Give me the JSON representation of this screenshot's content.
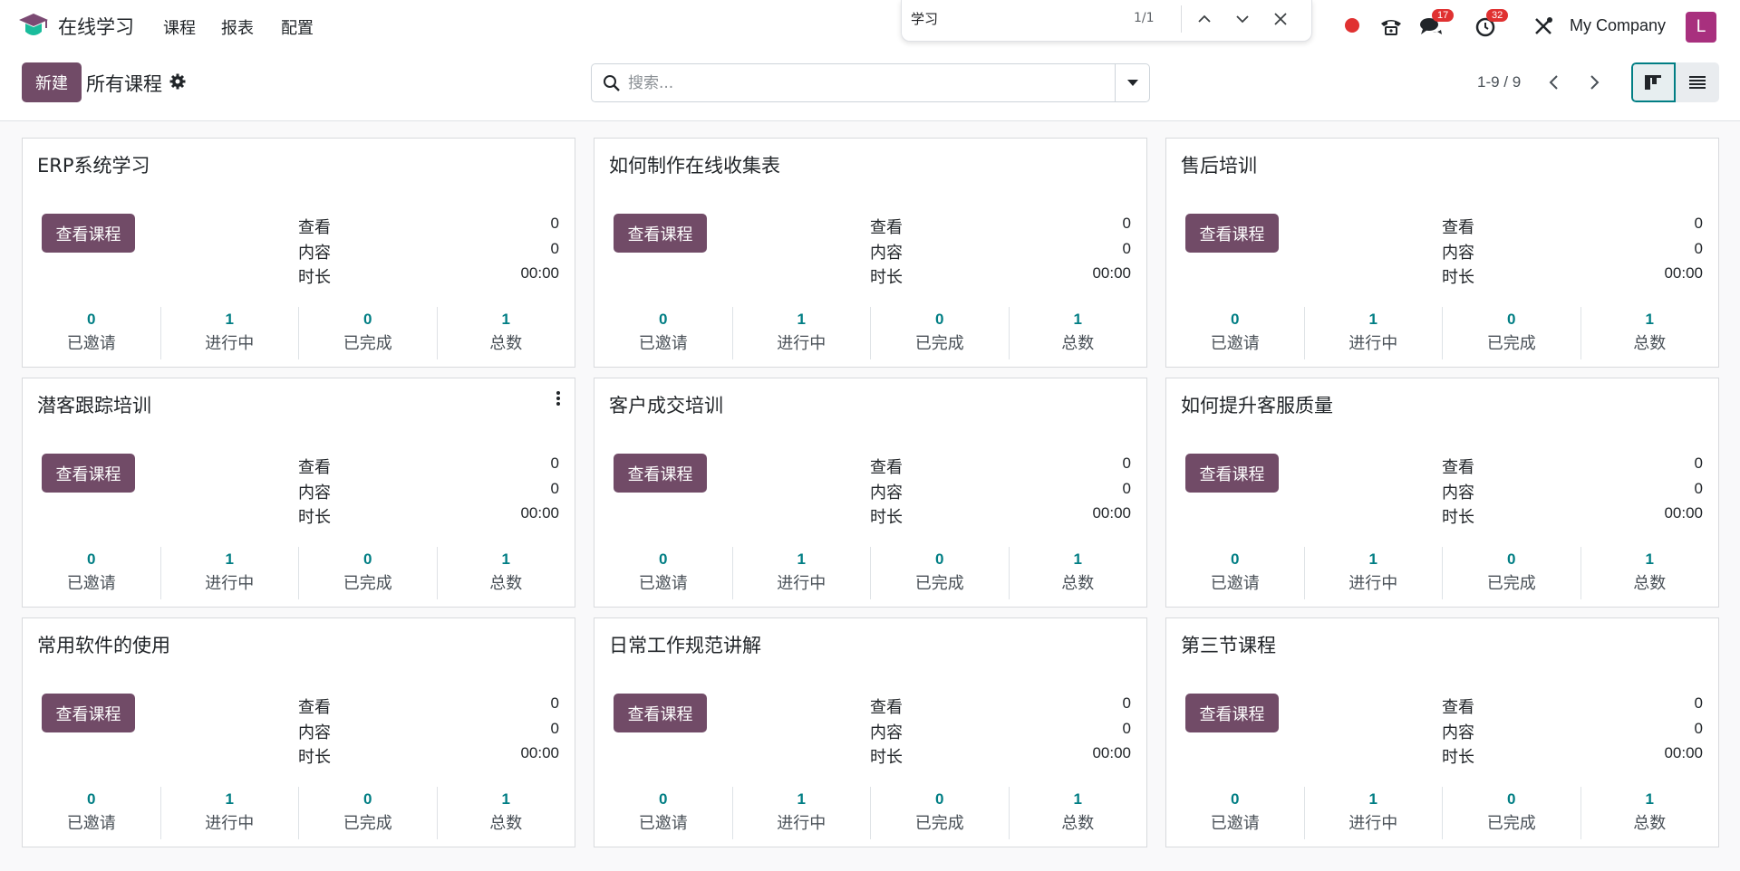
{
  "app": {
    "name": "在线学习",
    "menu": [
      "课程",
      "报表",
      "配置"
    ]
  },
  "findbar": {
    "query": "学习",
    "count": "1/1"
  },
  "systray": {
    "chat_badge": "17",
    "activity_badge": "32",
    "company": "My Company",
    "avatar_letter": "L"
  },
  "control": {
    "new_label": "新建",
    "breadcrumb": "所有课程",
    "search_placeholder": "搜索...",
    "pager": "1-9 / 9"
  },
  "icons": {
    "logo": "graduation-cap-icon",
    "view_kanban": "kanban-icon",
    "view_list": "list-icon"
  },
  "colors": {
    "primary": "#714b67",
    "accent": "#017e84",
    "badge": "#e03131",
    "avatar": "#a8307e"
  },
  "cards": [
    {
      "title": "ERP系统学习",
      "button": "查看课程",
      "stats": [
        {
          "label": "查看",
          "value": "0"
        },
        {
          "label": "内容",
          "value": "0"
        },
        {
          "label": "时长",
          "value": "00:00"
        }
      ],
      "counts": [
        {
          "num": "0",
          "label": "已邀请"
        },
        {
          "num": "1",
          "label": "进行中"
        },
        {
          "num": "0",
          "label": "已完成"
        },
        {
          "num": "1",
          "label": "总数"
        }
      ]
    },
    {
      "title": "如何制作在线收集表",
      "button": "查看课程",
      "stats": [
        {
          "label": "查看",
          "value": "0"
        },
        {
          "label": "内容",
          "value": "0"
        },
        {
          "label": "时长",
          "value": "00:00"
        }
      ],
      "counts": [
        {
          "num": "0",
          "label": "已邀请"
        },
        {
          "num": "1",
          "label": "进行中"
        },
        {
          "num": "0",
          "label": "已完成"
        },
        {
          "num": "1",
          "label": "总数"
        }
      ]
    },
    {
      "title": "售后培训",
      "button": "查看课程",
      "stats": [
        {
          "label": "查看",
          "value": "0"
        },
        {
          "label": "内容",
          "value": "0"
        },
        {
          "label": "时长",
          "value": "00:00"
        }
      ],
      "counts": [
        {
          "num": "0",
          "label": "已邀请"
        },
        {
          "num": "1",
          "label": "进行中"
        },
        {
          "num": "0",
          "label": "已完成"
        },
        {
          "num": "1",
          "label": "总数"
        }
      ]
    },
    {
      "title": "潜客跟踪培训",
      "button": "查看课程",
      "stats": [
        {
          "label": "查看",
          "value": "0"
        },
        {
          "label": "内容",
          "value": "0"
        },
        {
          "label": "时长",
          "value": "00:00"
        }
      ],
      "counts": [
        {
          "num": "0",
          "label": "已邀请"
        },
        {
          "num": "1",
          "label": "进行中"
        },
        {
          "num": "0",
          "label": "已完成"
        },
        {
          "num": "1",
          "label": "总数"
        }
      ]
    },
    {
      "title": "客户成交培训",
      "button": "查看课程",
      "stats": [
        {
          "label": "查看",
          "value": "0"
        },
        {
          "label": "内容",
          "value": "0"
        },
        {
          "label": "时长",
          "value": "00:00"
        }
      ],
      "counts": [
        {
          "num": "0",
          "label": "已邀请"
        },
        {
          "num": "1",
          "label": "进行中"
        },
        {
          "num": "0",
          "label": "已完成"
        },
        {
          "num": "1",
          "label": "总数"
        }
      ]
    },
    {
      "title": "如何提升客服质量",
      "button": "查看课程",
      "stats": [
        {
          "label": "查看",
          "value": "0"
        },
        {
          "label": "内容",
          "value": "0"
        },
        {
          "label": "时长",
          "value": "00:00"
        }
      ],
      "counts": [
        {
          "num": "0",
          "label": "已邀请"
        },
        {
          "num": "1",
          "label": "进行中"
        },
        {
          "num": "0",
          "label": "已完成"
        },
        {
          "num": "1",
          "label": "总数"
        }
      ]
    },
    {
      "title": "常用软件的使用",
      "button": "查看课程",
      "stats": [
        {
          "label": "查看",
          "value": "0"
        },
        {
          "label": "内容",
          "value": "0"
        },
        {
          "label": "时长",
          "value": "00:00"
        }
      ],
      "counts": [
        {
          "num": "0",
          "label": "已邀请"
        },
        {
          "num": "1",
          "label": "进行中"
        },
        {
          "num": "0",
          "label": "已完成"
        },
        {
          "num": "1",
          "label": "总数"
        }
      ]
    },
    {
      "title": "日常工作规范讲解",
      "button": "查看课程",
      "stats": [
        {
          "label": "查看",
          "value": "0"
        },
        {
          "label": "内容",
          "value": "0"
        },
        {
          "label": "时长",
          "value": "00:00"
        }
      ],
      "counts": [
        {
          "num": "0",
          "label": "已邀请"
        },
        {
          "num": "1",
          "label": "进行中"
        },
        {
          "num": "0",
          "label": "已完成"
        },
        {
          "num": "1",
          "label": "总数"
        }
      ]
    },
    {
      "title": "第三节课程",
      "button": "查看课程",
      "stats": [
        {
          "label": "查看",
          "value": "0"
        },
        {
          "label": "内容",
          "value": "0"
        },
        {
          "label": "时长",
          "value": "00:00"
        }
      ],
      "counts": [
        {
          "num": "0",
          "label": "已邀请"
        },
        {
          "num": "1",
          "label": "进行中"
        },
        {
          "num": "0",
          "label": "已完成"
        },
        {
          "num": "1",
          "label": "总数"
        }
      ]
    }
  ]
}
